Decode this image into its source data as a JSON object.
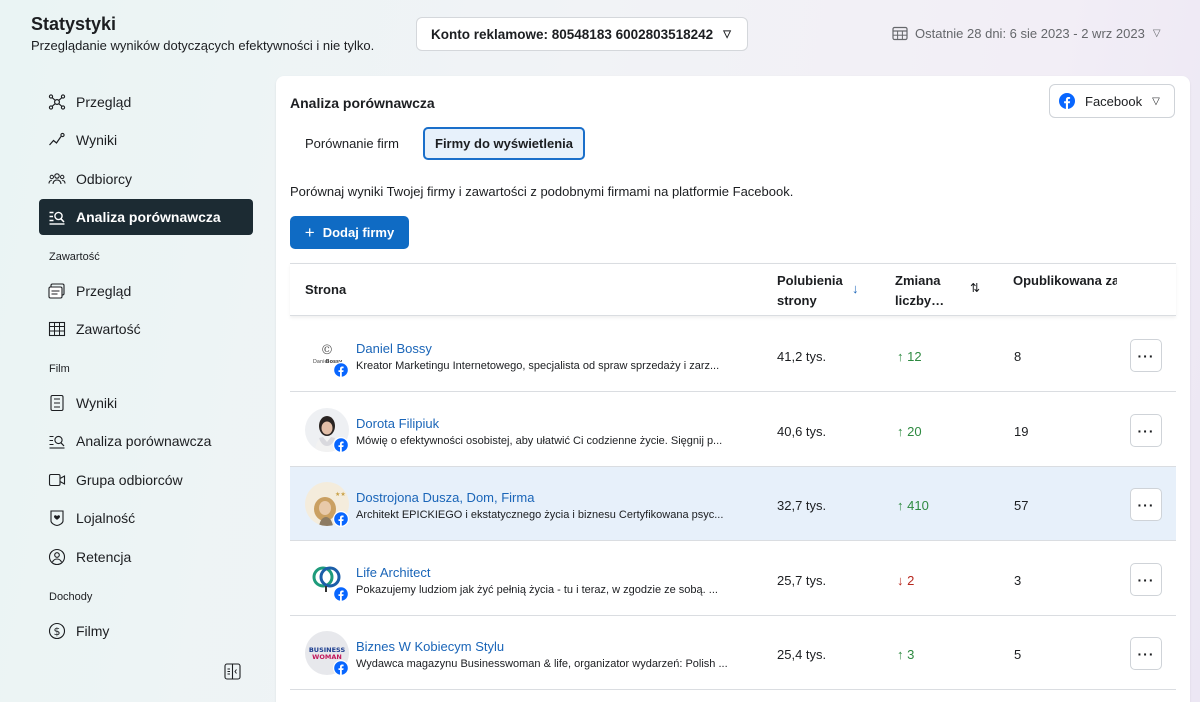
{
  "header": {
    "title": "Statystyki",
    "subtitle": "Przeglądanie wyników dotyczących efektywności i nie tylko.",
    "account_label": "Konto reklamowe: 80548183 6002803518242",
    "date_range": "Ostatnie 28 dni: 6 sie 2023 - 2 wrz 2023"
  },
  "sidebar": {
    "items": [
      {
        "label": "Przegląd",
        "icon": "network-icon"
      },
      {
        "label": "Wyniki",
        "icon": "trend-line-icon"
      },
      {
        "label": "Odbiorcy",
        "icon": "people-icon"
      },
      {
        "label": "Analiza porównawcza",
        "icon": "benchmark-icon",
        "active": true
      }
    ],
    "section_content": "Zawartość",
    "content_items": [
      {
        "label": "Przegląd",
        "icon": "content-overview-icon"
      },
      {
        "label": "Zawartość",
        "icon": "table-icon"
      }
    ],
    "section_film": "Film",
    "film_items": [
      {
        "label": "Wyniki",
        "icon": "film-results-icon"
      },
      {
        "label": "Analiza porównawcza",
        "icon": "benchmark-icon"
      },
      {
        "label": "Grupa odbiorców",
        "icon": "video-icon"
      },
      {
        "label": "Lojalność",
        "icon": "loyalty-icon"
      },
      {
        "label": "Retencja",
        "icon": "retention-icon"
      }
    ],
    "section_income": "Dochody",
    "income_items": [
      {
        "label": "Filmy",
        "icon": "dollar-icon"
      }
    ]
  },
  "main": {
    "title": "Analiza porównawcza",
    "platform": "Facebook",
    "tabs": [
      {
        "label": "Porównanie firm",
        "active": false
      },
      {
        "label": "Firmy do wyświetlenia",
        "active": true
      }
    ],
    "description": "Porównaj wyniki Twojej firmy i zawartości z podobnymi firmami na platformie Facebook.",
    "add_button": "Dodaj firmy",
    "table": {
      "columns": {
        "page": "Strona",
        "likes": "Polubienia strony",
        "change": "Zmiana liczby…",
        "published": "Opublikowana zawartość"
      },
      "rows": [
        {
          "name": "Daniel Bossy",
          "desc": "Kreator Marketingu Internetowego, specjalista od spraw sprzedaży i zarz...",
          "likes": "41,2 tys.",
          "change": "↑ 12",
          "dir": "up",
          "published": "8"
        },
        {
          "name": "Dorota Filipiuk",
          "desc": "Mówię o efektywności osobistej, aby ułatwić Ci codzienne życie. Sięgnij p...",
          "likes": "40,6 tys.",
          "change": "↑ 20",
          "dir": "up",
          "published": "19"
        },
        {
          "name": "Dostrojona Dusza, Dom, Firma",
          "desc": "Architekt EPICKIEGO i ekstatycznego życia i biznesu Certyfikowana psyc...",
          "likes": "32,7 tys.",
          "change": "↑ 410",
          "dir": "up",
          "published": "57"
        },
        {
          "name": "Life Architect",
          "desc": "Pokazujemy ludziom jak żyć pełnią życia - tu i teraz, w zgodzie ze sobą. ...",
          "likes": "25,7 tys.",
          "change": "↓ 2",
          "dir": "down",
          "published": "3"
        },
        {
          "name": "Biznes W Kobiecym Stylu",
          "desc": "Wydawca magazynu Businesswoman & life, organizator wydarzeń: Polish ...",
          "likes": "25,4 tys.",
          "change": "↑ 3",
          "dir": "up",
          "published": "5"
        }
      ],
      "more_label": "···"
    }
  },
  "colors": {
    "active_nav": "#1c2b33",
    "primary": "#0f6bc4",
    "link": "#1a65b8",
    "up": "#2e8a41",
    "down": "#b7281f",
    "selected_row": "#e7f0fa"
  }
}
